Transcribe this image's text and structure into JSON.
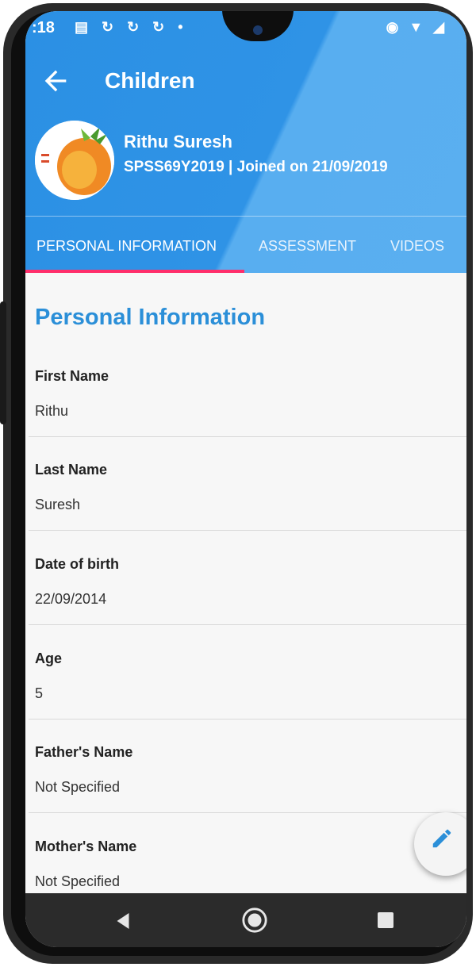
{
  "status_bar": {
    "time": ":18",
    "notification_icons": "▤ ↻ ↻ ↻ •",
    "right_icons": "◉ ▼ ◢"
  },
  "toolbar": {
    "title": "Children",
    "back_icon": "arrow-left-icon"
  },
  "child": {
    "name": "Rithu Suresh",
    "meta": "SPSS69Y2019 | Joined on 21/09/2019"
  },
  "tabs": [
    {
      "label": "PERSONAL INFORMATION",
      "active": true
    },
    {
      "label": "ASSESSMENT",
      "active": false
    },
    {
      "label": "VIDEOS",
      "active": false
    }
  ],
  "section": {
    "title": "Personal Information"
  },
  "fields": [
    {
      "label": "First Name",
      "value": "Rithu"
    },
    {
      "label": "Last Name",
      "value": "Suresh"
    },
    {
      "label": "Date of birth",
      "value": "22/09/2014"
    },
    {
      "label": "Age",
      "value": "5"
    },
    {
      "label": "Father's Name",
      "value": "Not Specified"
    },
    {
      "label": "Mother's Name",
      "value": "Not Specified"
    }
  ],
  "fab": {
    "icon": "pencil-edit-icon"
  },
  "colors": {
    "primary": "#2b90e4",
    "accent": "#ff2e6b",
    "section_title": "#2b8fd8"
  }
}
